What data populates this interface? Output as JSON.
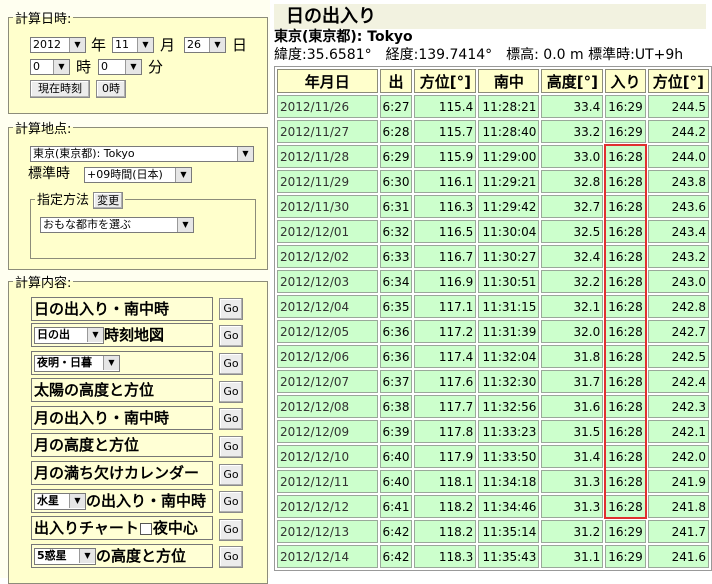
{
  "calc_datetime": {
    "legend": "計算日時:",
    "year": "2012",
    "year_unit": "年",
    "month": "11",
    "month_unit": "月",
    "day": "26",
    "day_unit": "日",
    "hour": "0",
    "hour_unit": "時",
    "minute": "0",
    "minute_unit": "分",
    "now_button": "現在時刻",
    "zero_button": "0時"
  },
  "calc_location": {
    "legend": "計算地点:",
    "city": "東京(東京都): Tokyo",
    "timezone_label": "標準時",
    "timezone": "+09時間(日本)",
    "method_legend": "指定方法",
    "change_button": "変更",
    "method": "おもな都市を選ぶ"
  },
  "calc_content": {
    "legend": "計算内容:",
    "go_label": "Go",
    "items": [
      {
        "label": "日の出入り・南中時"
      },
      {
        "select": "日の出",
        "label": "時刻地図"
      },
      {
        "select": "夜明・日暮",
        "label": ""
      },
      {
        "label": "太陽の高度と方位"
      },
      {
        "label": "月の出入り・南中時"
      },
      {
        "label": "月の高度と方位"
      },
      {
        "label": "月の満ち欠けカレンダー"
      },
      {
        "select": "水星",
        "label": "の出入り・南中時"
      },
      {
        "label": "出入りチャート",
        "check_label": "夜中心"
      },
      {
        "select": "5惑星",
        "label": "の高度と方位"
      }
    ]
  },
  "result": {
    "title": "日の出入り",
    "location": "東京(東京都): Tokyo",
    "info": "緯度:35.6581°　経度:139.7414°　標高: 0.0 m 標準時:UT+9h",
    "headers": [
      "年月日",
      "出",
      "方位[°]",
      "南中",
      "高度[°]",
      "入り",
      "方位[°]"
    ],
    "rows": [
      [
        "2012/11/26",
        "6:27",
        "115.4",
        "11:28:21",
        "33.4",
        "16:29",
        "244.5"
      ],
      [
        "2012/11/27",
        "6:28",
        "115.7",
        "11:28:40",
        "33.2",
        "16:29",
        "244.2"
      ],
      [
        "2012/11/28",
        "6:29",
        "115.9",
        "11:29:00",
        "33.0",
        "16:28",
        "244.0"
      ],
      [
        "2012/11/29",
        "6:30",
        "116.1",
        "11:29:21",
        "32.8",
        "16:28",
        "243.8"
      ],
      [
        "2012/11/30",
        "6:31",
        "116.3",
        "11:29:42",
        "32.7",
        "16:28",
        "243.6"
      ],
      [
        "2012/12/01",
        "6:32",
        "116.5",
        "11:30:04",
        "32.5",
        "16:28",
        "243.4"
      ],
      [
        "2012/12/02",
        "6:33",
        "116.7",
        "11:30:27",
        "32.4",
        "16:28",
        "243.2"
      ],
      [
        "2012/12/03",
        "6:34",
        "116.9",
        "11:30:51",
        "32.2",
        "16:28",
        "243.0"
      ],
      [
        "2012/12/04",
        "6:35",
        "117.1",
        "11:31:15",
        "32.1",
        "16:28",
        "242.8"
      ],
      [
        "2012/12/05",
        "6:36",
        "117.2",
        "11:31:39",
        "32.0",
        "16:28",
        "242.7"
      ],
      [
        "2012/12/06",
        "6:36",
        "117.4",
        "11:32:04",
        "31.8",
        "16:28",
        "242.5"
      ],
      [
        "2012/12/07",
        "6:37",
        "117.6",
        "11:32:30",
        "31.7",
        "16:28",
        "242.4"
      ],
      [
        "2012/12/08",
        "6:38",
        "117.7",
        "11:32:56",
        "31.6",
        "16:28",
        "242.3"
      ],
      [
        "2012/12/09",
        "6:39",
        "117.8",
        "11:33:23",
        "31.5",
        "16:28",
        "242.1"
      ],
      [
        "2012/12/10",
        "6:40",
        "117.9",
        "11:33:50",
        "31.4",
        "16:28",
        "242.0"
      ],
      [
        "2012/12/11",
        "6:40",
        "118.1",
        "11:34:18",
        "31.3",
        "16:28",
        "241.9"
      ],
      [
        "2012/12/12",
        "6:41",
        "118.2",
        "11:34:46",
        "31.3",
        "16:28",
        "241.8"
      ],
      [
        "2012/12/13",
        "6:42",
        "118.2",
        "11:35:14",
        "31.2",
        "16:29",
        "241.7"
      ],
      [
        "2012/12/14",
        "6:42",
        "118.3",
        "11:35:43",
        "31.1",
        "16:29",
        "241.6"
      ]
    ],
    "highlight_color": "#e03030"
  }
}
